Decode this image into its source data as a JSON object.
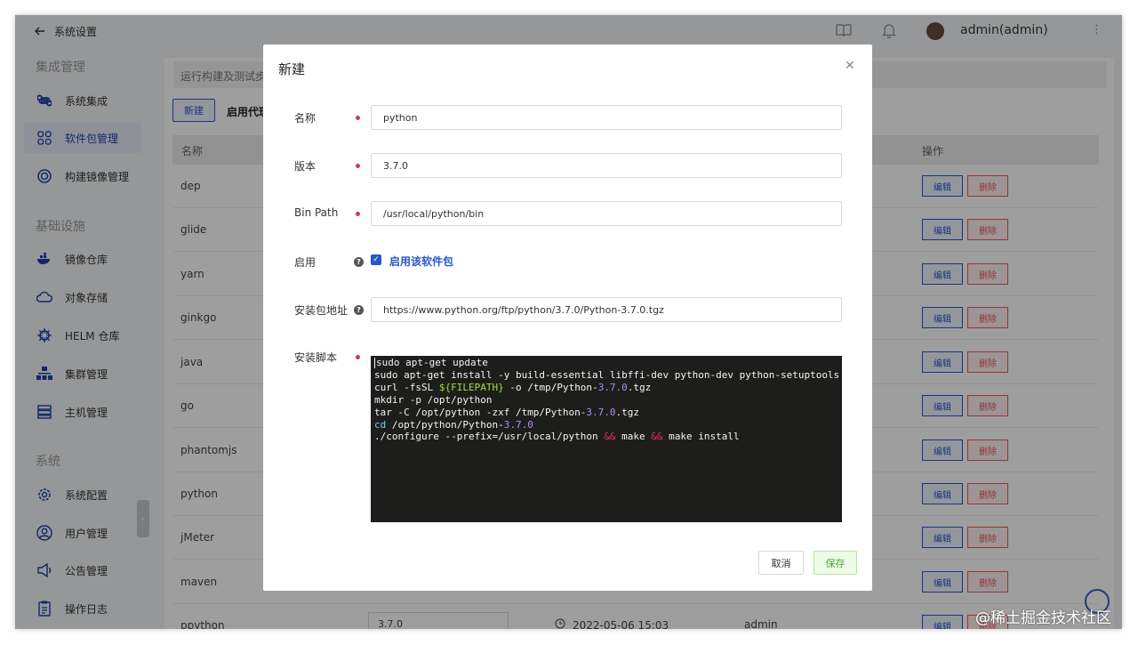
{
  "sidebar": {
    "back_label": "系统设置",
    "sections": [
      {
        "title": "集成管理",
        "items": [
          {
            "label": "系统集成",
            "icon": "command-icon"
          },
          {
            "label": "软件包管理",
            "icon": "grid-icon",
            "active": true
          },
          {
            "label": "构建镜像管理",
            "icon": "target-icon"
          }
        ]
      },
      {
        "title": "基础设施",
        "items": [
          {
            "label": "镜像仓库",
            "icon": "docker-icon"
          },
          {
            "label": "对象存储",
            "icon": "cloud-icon"
          },
          {
            "label": "HELM 仓库",
            "icon": "helm-icon"
          },
          {
            "label": "集群管理",
            "icon": "cluster-icon"
          },
          {
            "label": "主机管理",
            "icon": "server-icon"
          }
        ]
      },
      {
        "title": "系统",
        "items": [
          {
            "label": "系统配置",
            "icon": "settings-icon"
          },
          {
            "label": "用户管理",
            "icon": "user-icon"
          },
          {
            "label": "公告管理",
            "icon": "megaphone-icon"
          },
          {
            "label": "操作日志",
            "icon": "log-icon"
          }
        ]
      }
    ]
  },
  "header": {
    "user": "admin(admin)"
  },
  "main": {
    "info_text": "运行构建及测试步",
    "new_button": "新建",
    "proxy_label": "启用代理",
    "columns": {
      "name": "名称",
      "operation": "操作"
    },
    "rows": [
      {
        "name": "dep"
      },
      {
        "name": "glide"
      },
      {
        "name": "yarn"
      },
      {
        "name": "ginkgo"
      },
      {
        "name": "java"
      },
      {
        "name": "go"
      },
      {
        "name": "phantomjs"
      },
      {
        "name": "python"
      },
      {
        "name": "jMeter"
      },
      {
        "name": "maven"
      },
      {
        "name": "ppython",
        "version": "3.7.0",
        "time": "2022-05-06 15:03",
        "creator": "admin"
      }
    ],
    "edit_label": "编辑",
    "delete_label": "删除"
  },
  "modal": {
    "title": "新建",
    "fields": {
      "name_label": "名称",
      "name_value": "python",
      "version_label": "版本",
      "version_value": "3.7.0",
      "binpath_label": "Bin Path",
      "binpath_value": "/usr/local/python/bin",
      "enable_label": "启用",
      "enable_checkbox_label": "启用该软件包",
      "url_label": "安装包地址",
      "url_value": "https://www.python.org/ftp/python/3.7.0/Python-3.7.0.tgz",
      "script_label": "安装脚本"
    },
    "script_lines": [
      "sudo apt-get update",
      "sudo apt-get install -y build-essential libffi-dev python-dev python-setuptools python",
      "curl -fsSL ${FILEPATH} -o /tmp/Python-3.7.0.tgz",
      "mkdir -p /opt/python",
      "tar -C /opt/python -zxf /tmp/Python-3.7.0.tgz",
      "cd /opt/python/Python-3.7.0",
      "./configure --prefix=/usr/local/python && make && make install"
    ],
    "cancel_label": "取消",
    "save_label": "保存"
  },
  "watermark": "@稀土掘金技术社区",
  "colors": {
    "accent": "#2a56c8",
    "danger": "#e85a5a",
    "success": "#52a735",
    "code_bg": "#1d1e1b"
  }
}
